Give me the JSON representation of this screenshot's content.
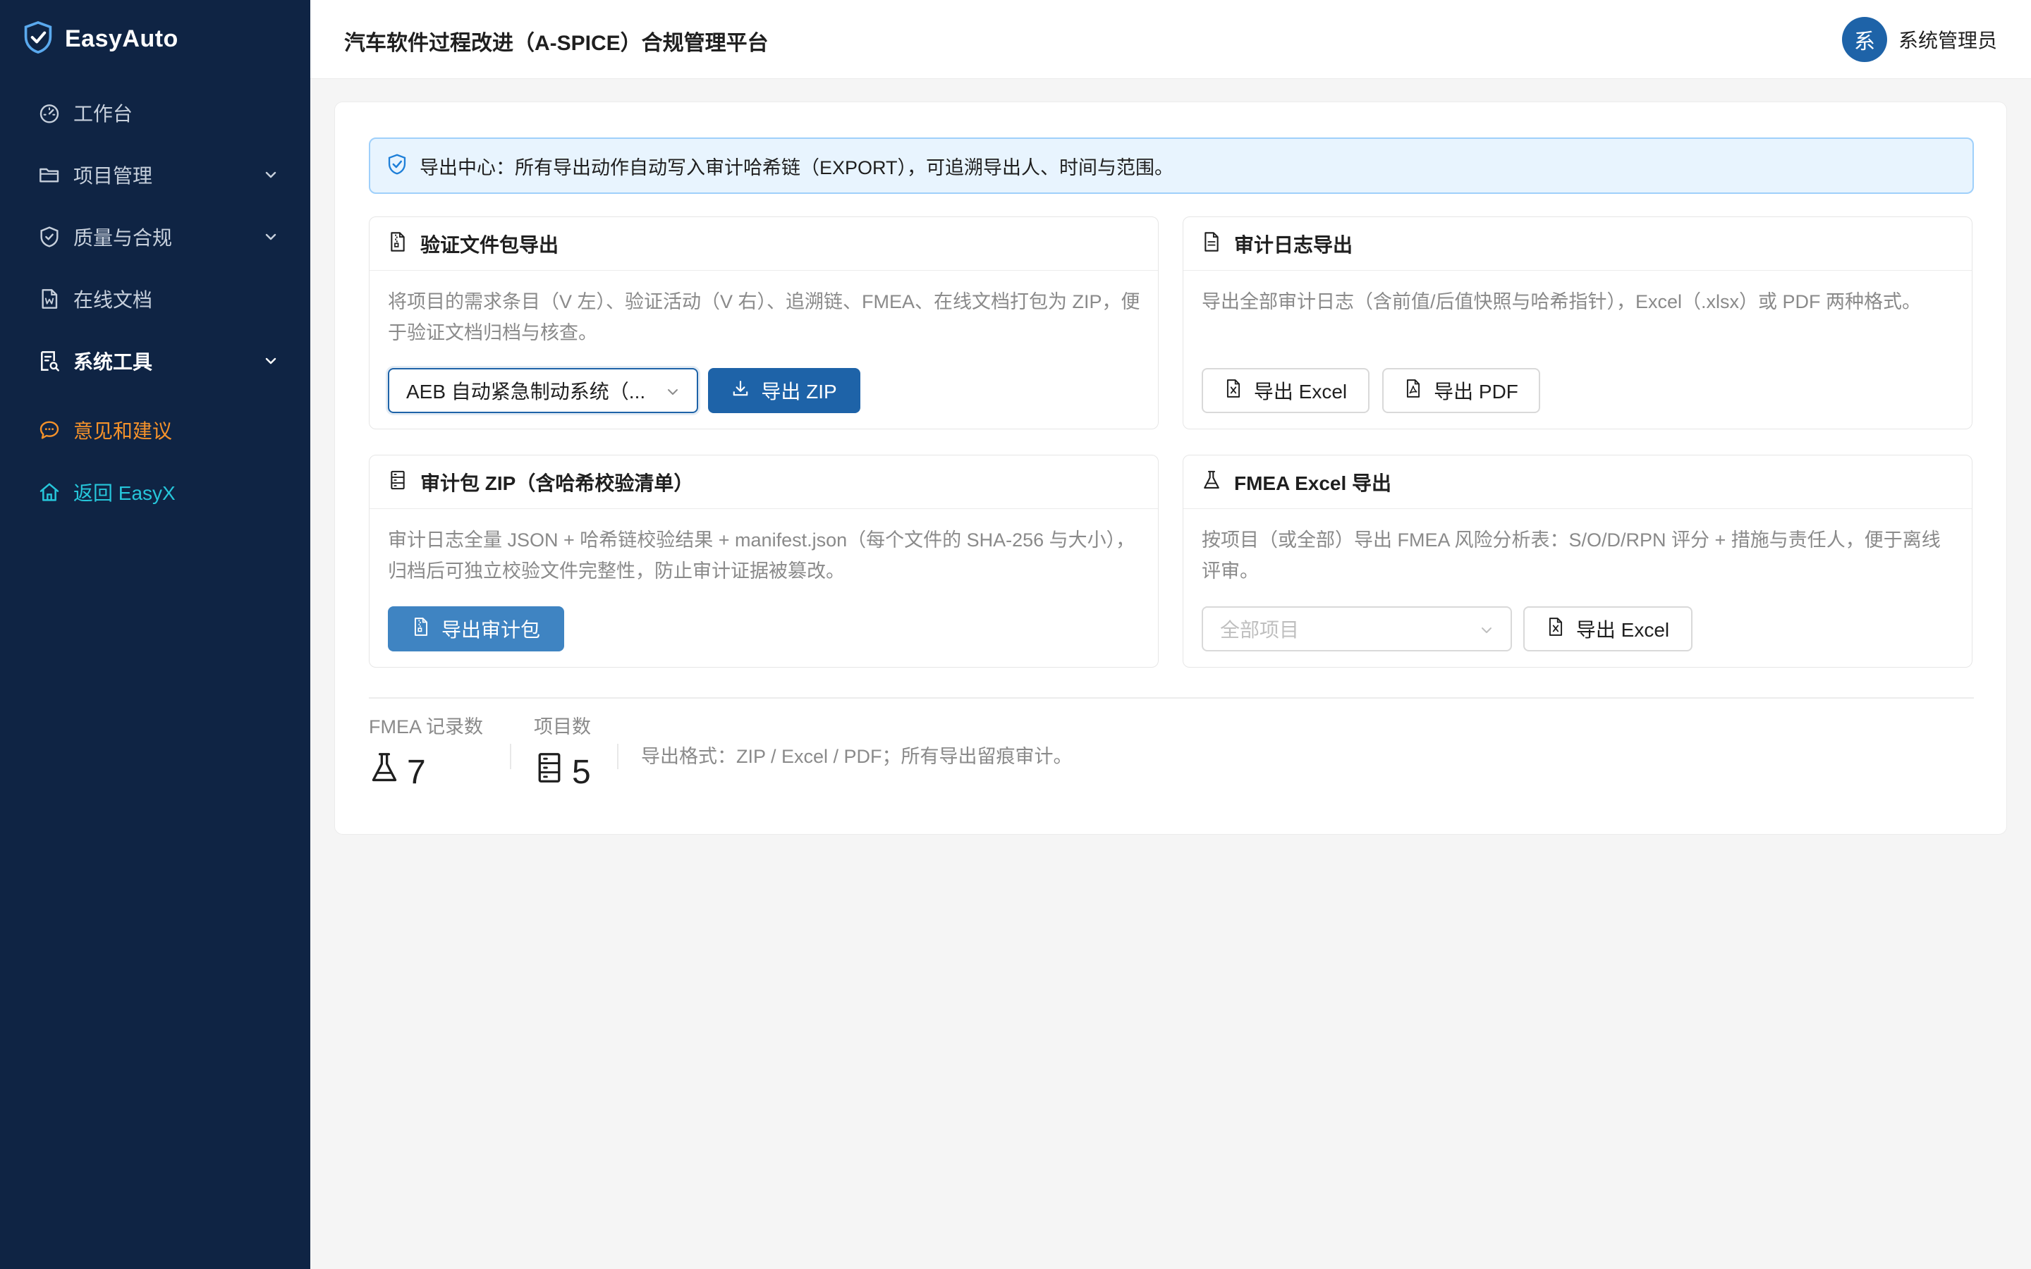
{
  "app": {
    "name": "EasyAuto",
    "page_title": "汽车软件过程改进（A-SPICE）合规管理平台"
  },
  "colors": {
    "sidebar_bg": "#0f2444",
    "primary": "#1e63a8",
    "feedback": "#f5922a",
    "back_link": "#26c6da",
    "alert_bg": "#e8f4fe"
  },
  "user": {
    "avatar_text": "系",
    "name": "系统管理员"
  },
  "sidebar": {
    "items": [
      {
        "label": "工作台",
        "icon": "dashboard-icon"
      },
      {
        "label": "项目管理",
        "icon": "folder-icon",
        "expandable": true
      },
      {
        "label": "质量与合规",
        "icon": "shield-icon",
        "expandable": true
      },
      {
        "label": "在线文档",
        "icon": "word-doc-icon"
      },
      {
        "label": "系统工具",
        "icon": "tools-icon",
        "expandable": true,
        "active": true
      },
      {
        "label": "意见和建议",
        "icon": "chat-icon"
      },
      {
        "label": "返回 EasyX",
        "icon": "home-icon"
      }
    ]
  },
  "alert": {
    "text": "导出中心：所有导出动作自动写入审计哈希链（EXPORT），可追溯导出人、时间与范围。"
  },
  "panels": {
    "validation": {
      "title": "验证文件包导出",
      "desc": "将项目的需求条目（V 左）、验证活动（V 右）、追溯链、FMEA、在线文档打包为 ZIP，便于验证文档归档与核查。",
      "select_value": "AEB 自动紧急制动系统（...",
      "export_label": "导出 ZIP"
    },
    "audit_log": {
      "title": "审计日志导出",
      "desc": "导出全部审计日志（含前值/后值快照与哈希指针），Excel（.xlsx）或 PDF 两种格式。",
      "excel_label": "导出 Excel",
      "pdf_label": "导出 PDF"
    },
    "audit_pack": {
      "title": "审计包 ZIP（含哈希校验清单）",
      "desc": "审计日志全量 JSON + 哈希链校验结果 + manifest.json（每个文件的 SHA-256 与大小），归档后可独立校验文件完整性，防止审计证据被篡改。",
      "export_label": "导出审计包"
    },
    "fmea": {
      "title": "FMEA Excel 导出",
      "desc": "按项目（或全部）导出 FMEA 风险分析表：S/O/D/RPN 评分 + 措施与责任人，便于离线评审。",
      "select_placeholder": "全部项目",
      "export_label": "导出 Excel"
    }
  },
  "stats": {
    "fmea": {
      "label": "FMEA 记录数",
      "value": "7"
    },
    "projects": {
      "label": "项目数",
      "value": "5"
    },
    "note": "导出格式：ZIP / Excel / PDF；所有导出留痕审计。"
  }
}
